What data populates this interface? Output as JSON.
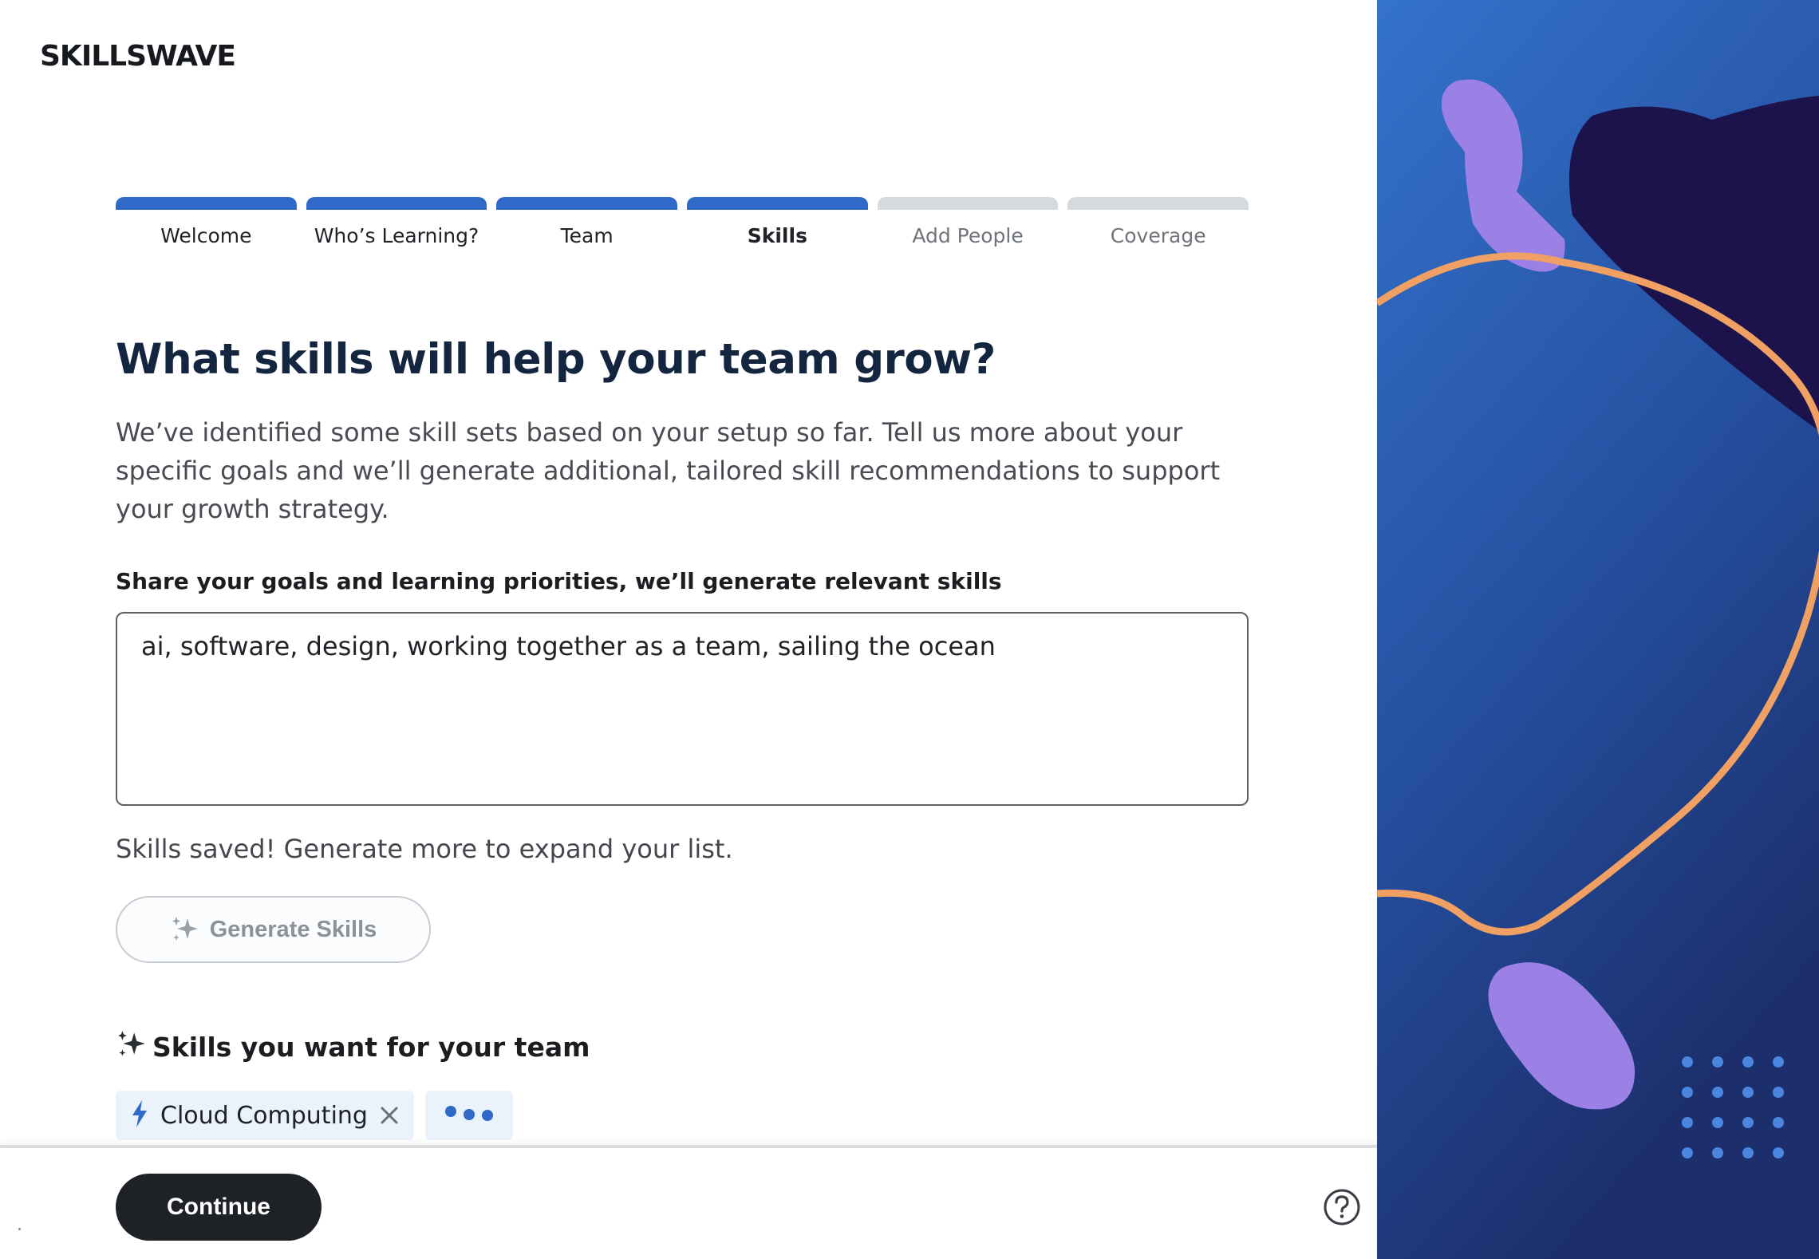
{
  "brand": {
    "logo_text": "SKILLSWAVE"
  },
  "stepper": {
    "steps": [
      {
        "label": "Welcome",
        "state": "done"
      },
      {
        "label": "Who’s Learning?",
        "state": "done"
      },
      {
        "label": "Team",
        "state": "done"
      },
      {
        "label": "Skills",
        "state": "current"
      },
      {
        "label": "Add People",
        "state": "future"
      },
      {
        "label": "Coverage",
        "state": "future"
      }
    ]
  },
  "main": {
    "heading": "What skills will help your team grow?",
    "intro": "We’ve identified some skill sets based on your setup so far. Tell us more about your specific goals and we’ll generate additional, tailored skill recommendations to support your growth strategy.",
    "goals_label": "Share your goals and learning priorities, we’ll generate relevant skills",
    "goals_value": "ai, software, design, working together as a team, sailing the ocean",
    "saved_note": "Skills saved! Generate more to expand your list.",
    "generate_button": "Generate Skills",
    "skills_section_title": "Skills you want for your team",
    "chips": [
      {
        "label": "Cloud Computing",
        "icon": "lightning-icon"
      }
    ]
  },
  "footer": {
    "continue_label": "Continue",
    "help_icon": "help-circle-icon"
  },
  "colors": {
    "accent": "#2f6ac8",
    "heading": "#13253f",
    "panel_top": "#3472cc",
    "panel_bottom": "#1b2f6e",
    "blob_purple": "#9b80e6",
    "blob_dark": "#1c124c",
    "orange_line": "#f0a063"
  }
}
